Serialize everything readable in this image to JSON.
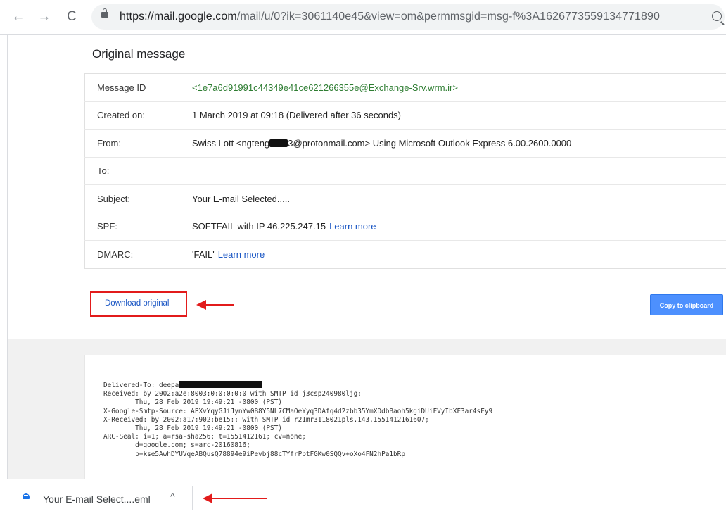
{
  "browser": {
    "back_label": "←",
    "forward_label": "→",
    "reload_label": "C",
    "url_host": "https://mail.google.com",
    "url_path": "/mail/u/0?ik=3061140e45&view=om&permmsgid=msg-f%3A1626773559134771890"
  },
  "page": {
    "title": "Original message",
    "rows": {
      "message_id": {
        "label": "Message ID",
        "value": "<1e7a6d91991c44349e41ce621266355e@Exchange-Srv.wrm.ir>"
      },
      "created": {
        "label": "Created on:",
        "value": "1 March 2019 at 09:18 (Delivered after 36 seconds)"
      },
      "from": {
        "label": "From:",
        "value_prefix": "Swiss Lott <ngteng",
        "value_suffix": "3@protonmail.com> Using Microsoft Outlook Express 6.00.2600.0000"
      },
      "to": {
        "label": "To:",
        "value": ""
      },
      "subject": {
        "label": "Subject:",
        "value": "Your E-mail Selected....."
      },
      "spf": {
        "label": "SPF:",
        "value": "SOFTFAIL with IP 46.225.247.15",
        "link": "Learn more"
      },
      "dmarc": {
        "label": "DMARC:",
        "value": "'FAIL'",
        "link": "Learn more"
      }
    },
    "download_label": "Download original",
    "copy_label": "Copy to clipboard"
  },
  "source": {
    "line1_prefix": "Delivered-To: deepa",
    "lines": [
      "Received: by 2002:a2e:8003:0:0:0:0:0 with SMTP id j3csp240980ljg;",
      "        Thu, 28 Feb 2019 19:49:21 -0800 (PST)",
      "X-Google-Smtp-Source: APXvYqyGJiJynYw0B8Y5NL7CMaOeYyq3DAfq4d2zbb35YmXDdbBaoh5kgiDUiFVyIbXF3ar4sEy9",
      "X-Received: by 2002:a17:902:be15:: with SMTP id r21mr3118021pls.143.1551412161607;",
      "        Thu, 28 Feb 2019 19:49:21 -0800 (PST)",
      "ARC-Seal: i=1; a=rsa-sha256; t=1551412161; cv=none;",
      "        d=google.com; s=arc-20160816;",
      "        b=kse5AwhDYUVqeABQusQ78894e9iPevbj88cTYfrPbtFGKw0SQQv+oXo4FN2hPa1bRp"
    ]
  },
  "download_shelf": {
    "filename": "Your E-mail Select....eml",
    "chevron": "^"
  },
  "colors": {
    "annotation_red": "#e21b1b",
    "link_blue": "#1a56c4",
    "message_id_green": "#2e7d32",
    "copy_button_blue": "#4d90fe"
  }
}
